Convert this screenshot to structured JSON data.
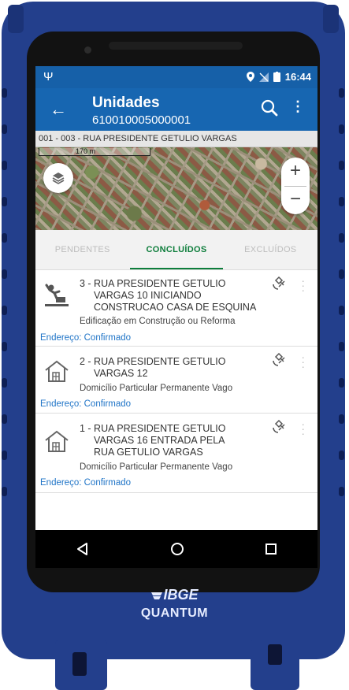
{
  "status_bar": {
    "time": "16:44"
  },
  "app_bar": {
    "title": "Unidades",
    "subtitle": "610010005000001"
  },
  "address_bar": {
    "text": "001 - 003 - RUA PRESIDENTE GETULIO VARGAS"
  },
  "map": {
    "scale_label": "170 m",
    "zoom_in": "+",
    "zoom_out": "−"
  },
  "tabs": [
    {
      "label": "PENDENTES",
      "active": false
    },
    {
      "label": "CONCLUÍDOS",
      "active": true
    },
    {
      "label": "EXCLUÍDOS",
      "active": false
    }
  ],
  "items": [
    {
      "address_lines": [
        "3 - RUA PRESIDENTE GETULIO",
        "VARGAS 10    INICIANDO",
        "CONSTRUCAO CASA DE ESQUINA"
      ],
      "type": "Edificação em Construção ou Reforma",
      "confirm": "Endereço: Confirmado",
      "icon": "construction-icon"
    },
    {
      "address_lines": [
        "2 - RUA PRESIDENTE GETULIO",
        "VARGAS 12"
      ],
      "type": "Domicílio Particular Permanente Vago",
      "confirm": "Endereço: Confirmado",
      "icon": "house-icon"
    },
    {
      "address_lines": [
        "1 - RUA PRESIDENTE GETULIO",
        "VARGAS 16    ENTRADA PELA",
        "RUA GETULIO VARGAS"
      ],
      "type": "Domicílio Particular Permanente Vago",
      "confirm": "Endereço: Confirmado",
      "icon": "house-icon"
    }
  ],
  "brand": {
    "logo": "IBGE",
    "model": "QUANTUM"
  },
  "colors": {
    "status_bar": "#1660a8",
    "app_bar": "#1766b1",
    "tab_accent": "#0d7d3b",
    "link": "#1f74c7",
    "case": "#233f8c"
  }
}
